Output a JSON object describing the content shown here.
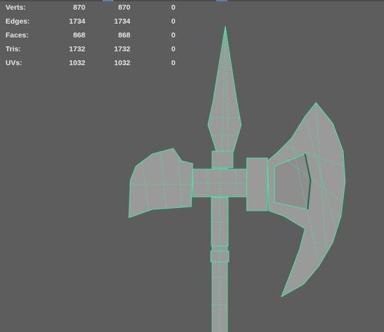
{
  "hud": {
    "rows": [
      {
        "label": "Verts:",
        "a": "870",
        "b": "870",
        "c": "0"
      },
      {
        "label": "Edges:",
        "a": "1734",
        "b": "1734",
        "c": "0"
      },
      {
        "label": "Faces:",
        "a": "868",
        "b": "868",
        "c": "0"
      },
      {
        "label": "Tris:",
        "a": "1732",
        "b": "1732",
        "c": "0"
      },
      {
        "label": "UVs:",
        "a": "1032",
        "b": "1032",
        "c": "0"
      }
    ]
  },
  "colors": {
    "background": "#5d5d5d",
    "mesh_fill": "#9a9a9a",
    "wire": "#3ee8a0",
    "hud_text": "#e6e6e6"
  },
  "viewport": {
    "object": "axe-mesh",
    "selection_mode": "edges-highlighted"
  }
}
